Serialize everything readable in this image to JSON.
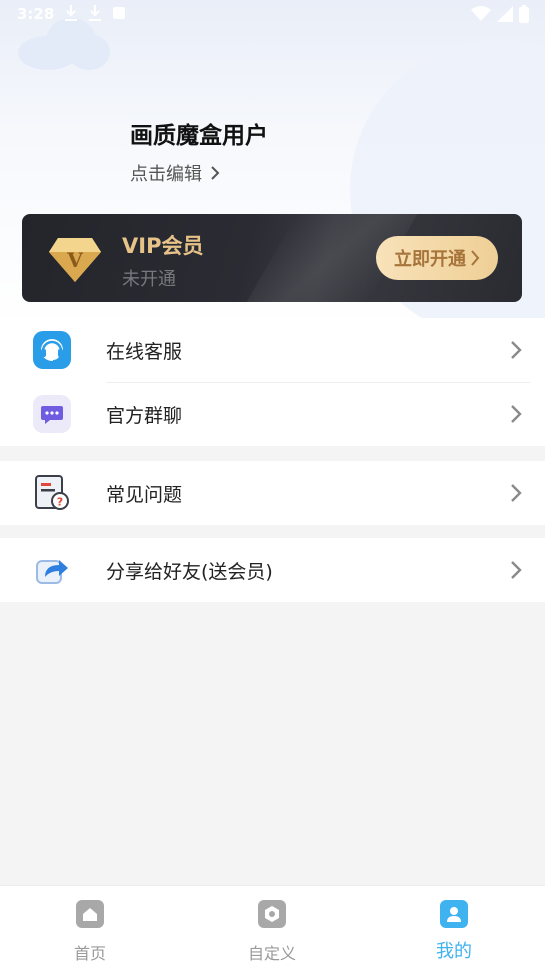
{
  "status_bar": {
    "time": "3:28"
  },
  "profile": {
    "username": "画质魔盒用户",
    "edit_label": "点击编辑"
  },
  "vip": {
    "title": "VIP会员",
    "status": "未开通",
    "button_label": "立即开通",
    "accent_color": "#e7c389"
  },
  "menu_groups": [
    {
      "items": [
        {
          "label": "在线客服",
          "icon": "headset-icon"
        },
        {
          "label": "官方群聊",
          "icon": "chat-bubble-icon"
        }
      ]
    },
    {
      "items": [
        {
          "label": "常见问题",
          "icon": "faq-document-icon"
        }
      ]
    },
    {
      "items": [
        {
          "label": "分享给好友(送会员)",
          "icon": "share-icon"
        }
      ]
    }
  ],
  "bottom_nav": {
    "items": [
      {
        "label": "首页",
        "icon": "home-icon",
        "active": false
      },
      {
        "label": "自定义",
        "icon": "customize-icon",
        "active": false
      },
      {
        "label": "我的",
        "icon": "profile-icon",
        "active": true
      }
    ],
    "active_color": "#3fb2f0"
  }
}
